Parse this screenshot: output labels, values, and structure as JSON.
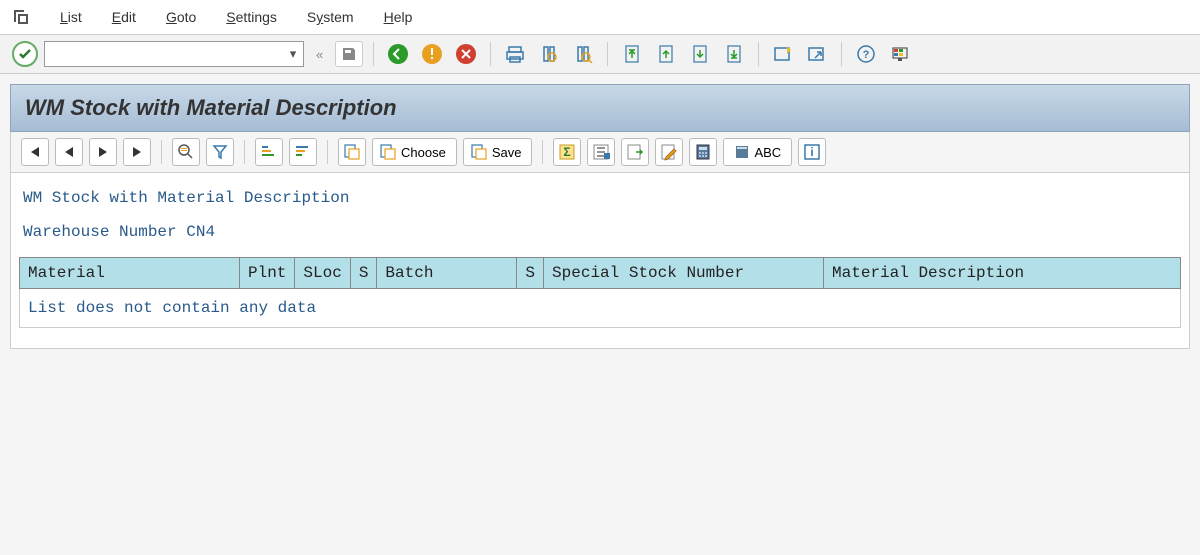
{
  "menu": {
    "list": "List",
    "edit": "Edit",
    "goto": "Goto",
    "settings": "Settings",
    "system": "System",
    "help": "Help"
  },
  "command_field": {
    "value": ""
  },
  "page_title": "WM Stock with Material Description",
  "toolbar2": {
    "choose": "Choose",
    "save": "Save",
    "abc": "ABC"
  },
  "report": {
    "title_line": "WM Stock with Material Description",
    "warehouse_label": "Warehouse Number",
    "warehouse_value": "CN4"
  },
  "table": {
    "columns": {
      "material": "Material",
      "plnt": "Plnt",
      "sloc": "SLoc",
      "s1": "S",
      "batch": "Batch",
      "s2": "S",
      "special_stock_number": "Special Stock Number",
      "material_description": "Material Description"
    },
    "empty_message": "List does not contain any data"
  }
}
